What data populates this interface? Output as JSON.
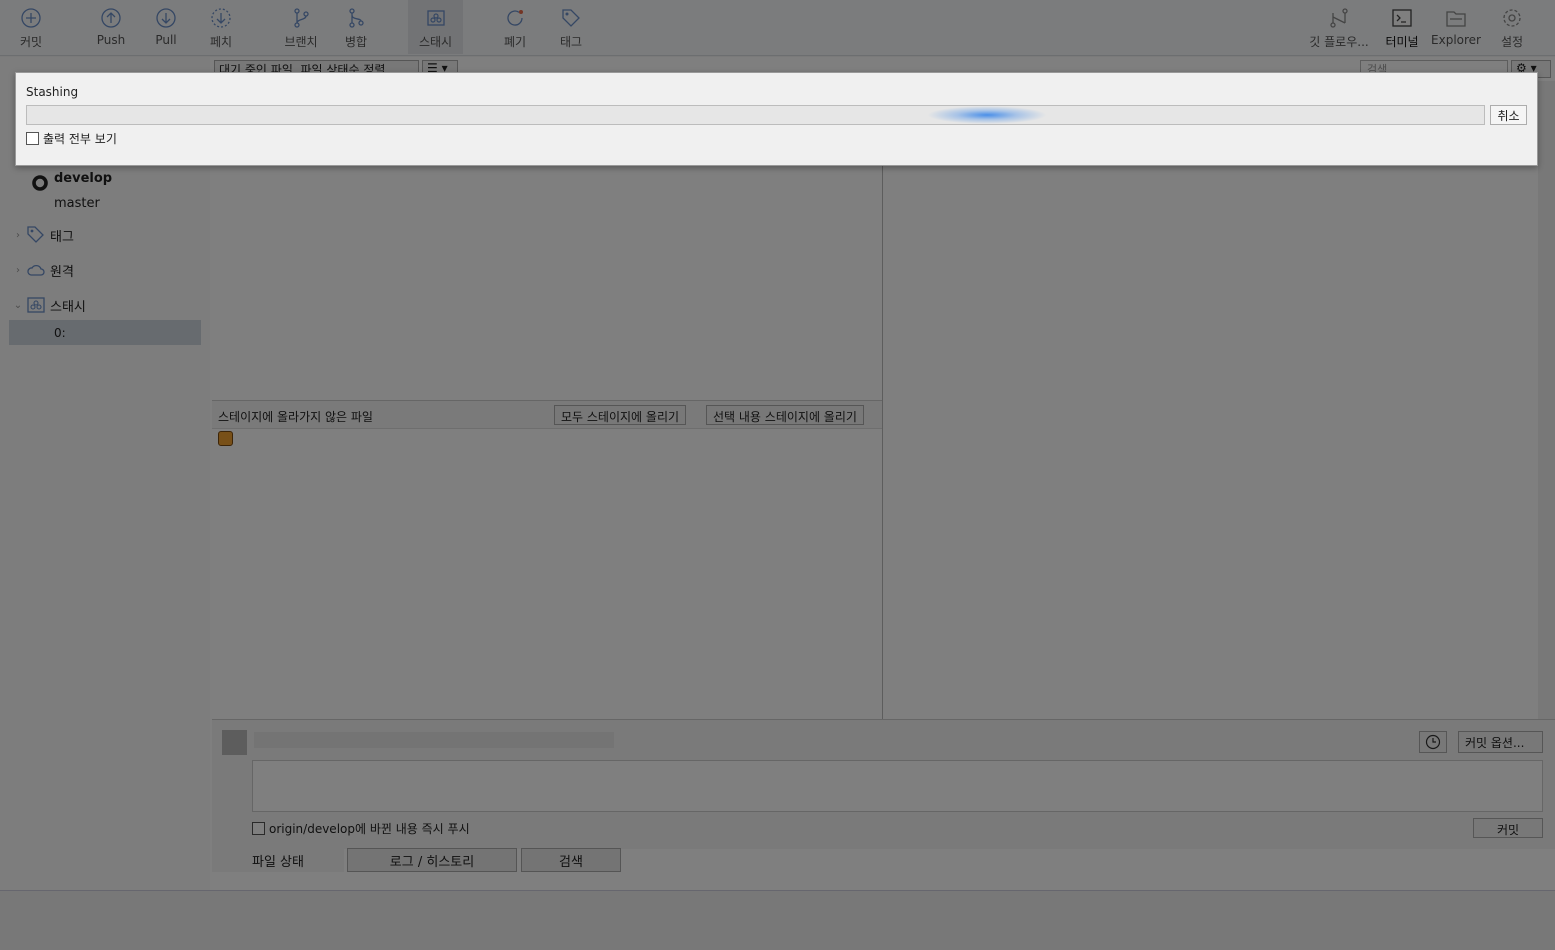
{
  "toolbar": {
    "commit": "커밋",
    "push": "Push",
    "pull": "Pull",
    "fetch": "페치",
    "branch": "브랜치",
    "merge": "병합",
    "stash": "스태시",
    "discard": "폐기",
    "tag": "태그",
    "git_flow": "깃 플로우...",
    "terminal": "터미널",
    "explorer": "Explorer",
    "settings": "설정"
  },
  "sidebar": {
    "branches": [
      {
        "label": "develop",
        "current": true
      },
      {
        "label": "master",
        "current": false
      }
    ],
    "tags_label": "태그",
    "remotes_label": "원격",
    "stashes_label": "스태시",
    "stash_items": [
      "0:"
    ]
  },
  "filter": {
    "file_status_dropdown": "대기 중인 파일, 파일 상태순 정렬",
    "search_placeholder": "검색"
  },
  "unstaged": {
    "title": "스테이지에 올라가지 않은 파일",
    "stage_all": "모두 스테이지에 올리기",
    "stage_selected": "선택 내용 스테이지에 올리기"
  },
  "commit": {
    "history_icon": "clock-icon",
    "options": "커밋 옵션...",
    "push_option": "origin/develop에 바뀐 내용 즉시 푸시",
    "commit_button": "커밋"
  },
  "tabs": [
    "파일 상태",
    "로그 / 히스토리",
    "검색"
  ],
  "dialog": {
    "title": "Stashing",
    "cancel": "취소",
    "show_output": "출력 전부 보기",
    "progress_state": "indeterminate"
  },
  "colors": {
    "accent": "#4a8fe8",
    "overlay": "rgba(0,0,0,0.5)"
  }
}
